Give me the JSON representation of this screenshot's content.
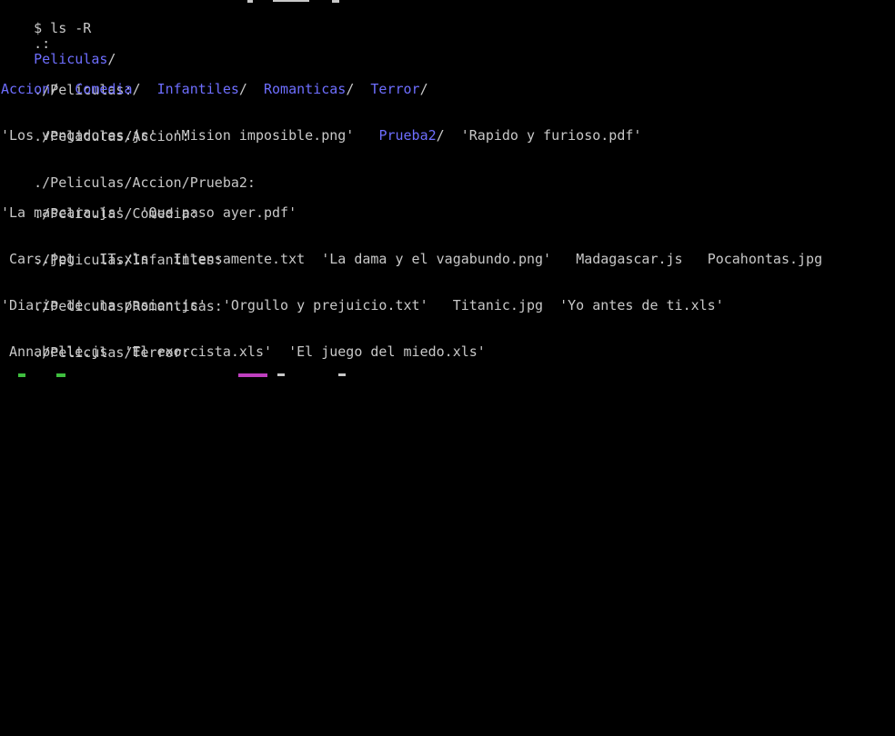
{
  "prompt": "$ ls -R",
  "sections": [
    {
      "header": ".:",
      "entries": [
        {
          "text": "Peliculas",
          "type": "dir"
        }
      ]
    },
    {
      "header": "./Películas:",
      "entries": [
        {
          "text": "Accion",
          "type": "dir"
        },
        {
          "text": "Comedia",
          "type": "dir"
        },
        {
          "text": "Infantiles",
          "type": "dir"
        },
        {
          "text": "Romanticas",
          "type": "dir"
        },
        {
          "text": "Terror",
          "type": "dir"
        }
      ]
    },
    {
      "header": "./Peliculas/Accion:",
      "entries": [
        {
          "text": "'Los vengadores.js'",
          "type": "file"
        },
        {
          "text": "'Mision imposible.png'",
          "type": "file"
        },
        {
          "text": "Prueba2",
          "type": "dir"
        },
        {
          "text": "'Rapido y furioso.pdf'",
          "type": "file"
        }
      ]
    },
    {
      "header": "./Peliculas/Accion/Prueba2:",
      "entries": []
    },
    {
      "header": "./Peliculas/Comedia:",
      "entries": [
        {
          "text": "'La mascara.js'",
          "type": "file"
        },
        {
          "text": "'Que paso ayer.pdf'",
          "type": "file"
        }
      ]
    },
    {
      "header": "./Peliculas/Infantiles:",
      "entries": [
        {
          "text": "Cars.jpg",
          "type": "file"
        },
        {
          "text": "IT.xls",
          "type": "file"
        },
        {
          "text": "Intensamente.txt",
          "type": "file"
        },
        {
          "text": "'La dama y el vagabundo.png'",
          "type": "file"
        },
        {
          "text": "Madagascar.js",
          "type": "file"
        },
        {
          "text": "Pocahontas.jpg",
          "type": "file"
        }
      ]
    },
    {
      "header": "./Peliculas/Romanticas:",
      "entries": [
        {
          "text": "'Diario de una pasion.js'",
          "type": "file"
        },
        {
          "text": "'Orgullo y prejuicio.txt'",
          "type": "file"
        },
        {
          "text": "Titanic.jpg",
          "type": "file"
        },
        {
          "text": "'Yo antes de ti.xls'",
          "type": "file"
        }
      ]
    },
    {
      "header": "./Peliculas/Terror:",
      "entries": [
        {
          "text": "Annabelle.js",
          "type": "file"
        },
        {
          "text": "'El exorcista.xls'",
          "type": "file"
        },
        {
          "text": "'El juego del miedo.xls'",
          "type": "file"
        }
      ]
    }
  ],
  "colors": {
    "background": "#000000",
    "text": "#c8c8c8",
    "directory": "#6e6eff"
  }
}
